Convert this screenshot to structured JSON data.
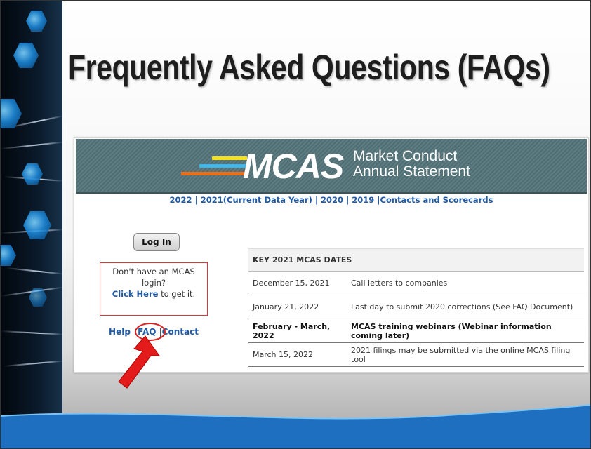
{
  "slide": {
    "title": "Frequently Asked Questions (FAQs)"
  },
  "banner": {
    "logo_text": "MCAS",
    "subtitle_line1": "Market Conduct",
    "subtitle_line2": "Annual Statement",
    "bar_colors": [
      "#f6e21b",
      "#3fb6e8",
      "#e86f1c"
    ]
  },
  "nav": {
    "items": [
      {
        "label": "2022"
      },
      {
        "label": "2021(Current Data Year)"
      },
      {
        "label": "2020"
      },
      {
        "label": "2019"
      },
      {
        "label": "Contacts and Scorecards"
      }
    ],
    "separator": " | "
  },
  "login": {
    "button_label": "Log In",
    "box_line1": "Don't have an MCAS",
    "box_line2": "login?",
    "box_link": "Click Here",
    "box_suffix": " to get it.",
    "help": "Help",
    "faq": "FAQ",
    "contact": "Contact",
    "sep": "|"
  },
  "dates_table": {
    "header": "KEY 2021 MCAS DATES",
    "rows": [
      {
        "date": "December 15, 2021",
        "event": "Call letters to companies",
        "bold": false
      },
      {
        "date": "January 21, 2022",
        "event": "Last day to submit 2020 corrections (See FAQ Document)",
        "bold": false
      },
      {
        "date": "February - March, 2022",
        "event": "MCAS training webinars (Webinar information coming later)",
        "bold": true
      },
      {
        "date": "March 15, 2022",
        "event": "2021 filings may be submitted via the online MCAS filing tool",
        "bold": false
      }
    ]
  },
  "colors": {
    "accent_red": "#e02020",
    "link_blue": "#1f5aa6",
    "banner_teal": "#56757b",
    "wave_blue": "#1f6fc0"
  }
}
